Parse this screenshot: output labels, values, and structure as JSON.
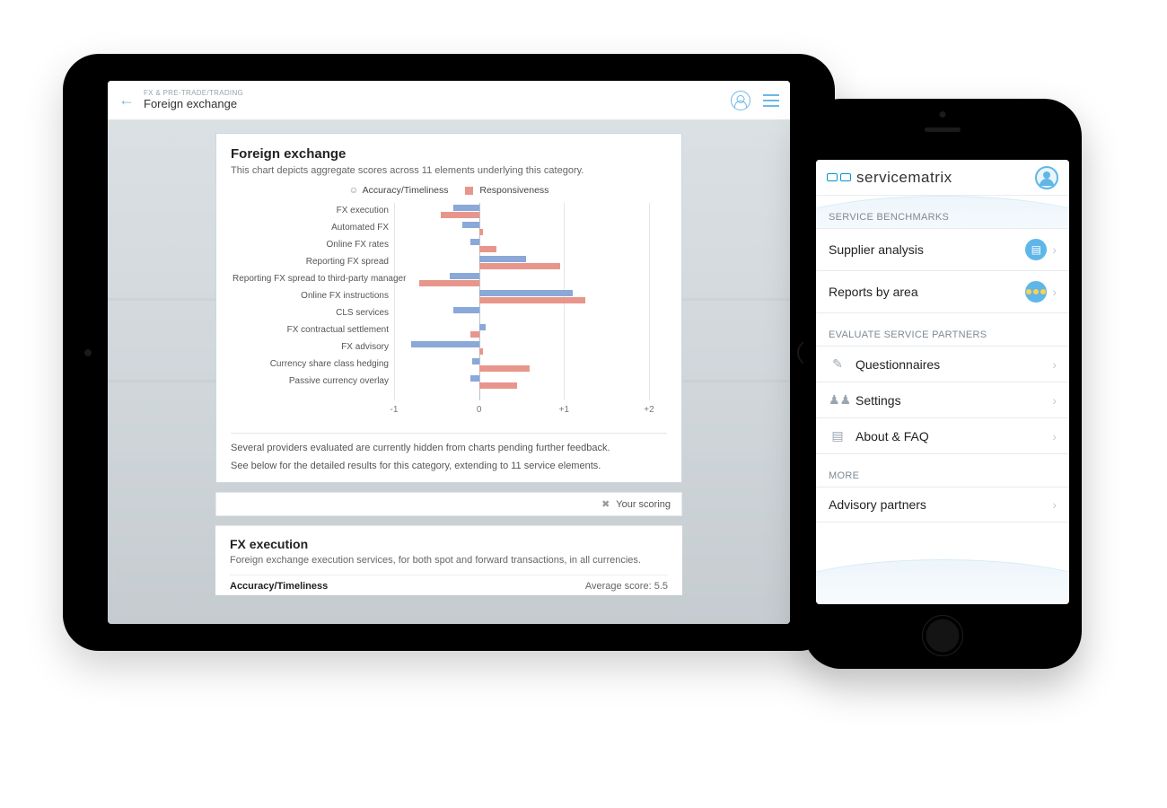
{
  "tablet": {
    "breadcrumb": "FX & PRE-TRADE/TRADING",
    "title": "Foreign exchange",
    "card": {
      "title": "Foreign exchange",
      "subtitle": "This chart depicts aggregate scores across 11 elements underlying this category.",
      "legend": {
        "series1": "Accuracy/Timeliness",
        "series2": "Responsiveness"
      },
      "footer1": "Several providers evaluated are currently hidden from charts pending further feedback.",
      "footer2": "See below for the detailed results for this category, extending to 11 service elements."
    },
    "scoring_label": "Your scoring",
    "detail": {
      "title": "FX execution",
      "desc": "Foreign exchange execution services, for both spot and forward transactions, in all currencies.",
      "metric": "Accuracy/Timeliness",
      "avg_label": "Average score:",
      "avg_value": "5.5"
    }
  },
  "phone": {
    "brand_a": "service",
    "brand_b": "matrix",
    "sections": {
      "s1": "SERVICE BENCHMARKS",
      "s2": "EVALUATE SERVICE PARTNERS",
      "s3": "MORE"
    },
    "items": {
      "supplier": "Supplier analysis",
      "reports": "Reports by area",
      "quest": "Questionnaires",
      "settings": "Settings",
      "about": "About & FAQ",
      "advisory": "Advisory partners"
    }
  },
  "chart_data": {
    "type": "bar",
    "orientation": "horizontal",
    "title": "Foreign exchange",
    "xlabel": "",
    "ylabel": "",
    "xlim": [
      -1,
      2
    ],
    "xticks": [
      -1,
      0,
      1,
      2
    ],
    "xtick_labels": [
      "-1",
      "0",
      "+1",
      "+2"
    ],
    "categories": [
      "FX execution",
      "Automated FX",
      "Online FX rates",
      "Reporting FX spread",
      "Reporting FX spread to third-party manager",
      "Online FX instructions",
      "CLS services",
      "FX contractual settlement",
      "FX advisory",
      "Currency share class hedging",
      "Passive currency overlay"
    ],
    "series": [
      {
        "name": "Accuracy/Timeliness",
        "color": "#8aa8d8",
        "values": [
          -0.3,
          -0.2,
          -0.1,
          0.55,
          -0.35,
          1.1,
          -0.3,
          0.08,
          -0.8,
          -0.08,
          -0.1
        ]
      },
      {
        "name": "Responsiveness",
        "color": "#e8968c",
        "values": [
          -0.45,
          0.05,
          0.2,
          0.95,
          -0.7,
          1.25,
          0.0,
          -0.1,
          0.05,
          0.6,
          0.45
        ]
      }
    ]
  }
}
